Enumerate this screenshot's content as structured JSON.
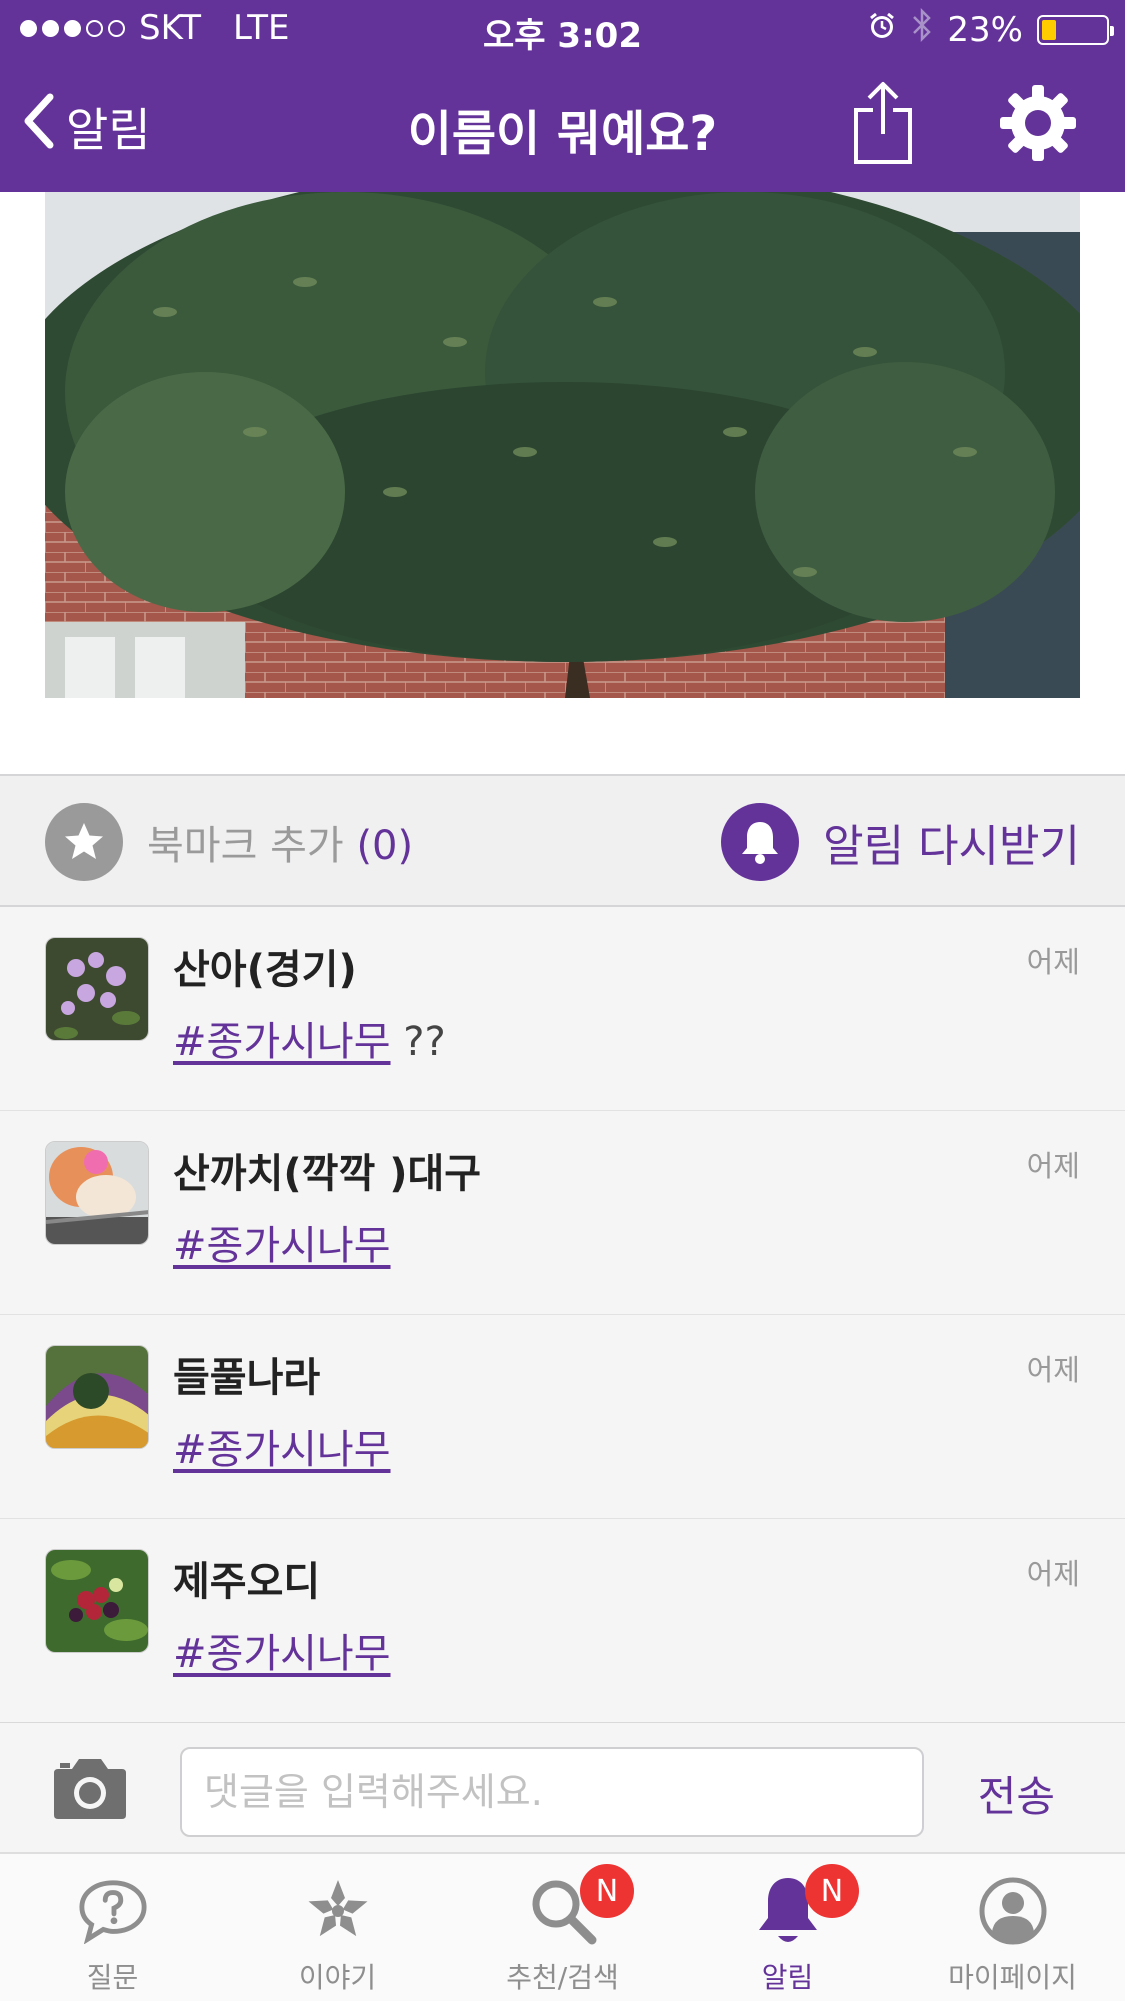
{
  "status_bar": {
    "carrier": "SKT",
    "network": "LTE",
    "time": "오후 3:02",
    "battery": "23%",
    "battery_level": 0.23
  },
  "nav": {
    "back_label": "알림",
    "title": "이름이 뭐예요?"
  },
  "actions": {
    "bookmark_label": "북마크 추가",
    "bookmark_count": "(0)",
    "renotify_label": "알림 다시받기"
  },
  "comments": [
    {
      "author": "산아(경기)",
      "time": "어제",
      "tag": "#종가시나무",
      "text": " ??"
    },
    {
      "author": "산까치(깍깍 )대구",
      "time": "어제",
      "tag": "#종가시나무",
      "text": ""
    },
    {
      "author": "들풀나라",
      "time": "어제",
      "tag": "#종가시나무",
      "text": ""
    },
    {
      "author": "제주오디",
      "time": "어제",
      "tag": "#종가시나무",
      "text": ""
    }
  ],
  "input": {
    "placeholder": "댓글을 입력해주세요.",
    "send_label": "전송"
  },
  "tabs": [
    {
      "label": "질문",
      "icon": "question-bubble-icon",
      "active": false,
      "badge": ""
    },
    {
      "label": "이야기",
      "icon": "flower-icon",
      "active": false,
      "badge": ""
    },
    {
      "label": "추천/검색",
      "icon": "search-icon",
      "active": false,
      "badge": "N"
    },
    {
      "label": "알림",
      "icon": "bell-icon",
      "active": true,
      "badge": "N"
    },
    {
      "label": "마이페이지",
      "icon": "person-icon",
      "active": false,
      "badge": ""
    }
  ],
  "colors": {
    "brand": "#64339a",
    "badge": "#ee3333",
    "battery": "#ffcc00"
  }
}
